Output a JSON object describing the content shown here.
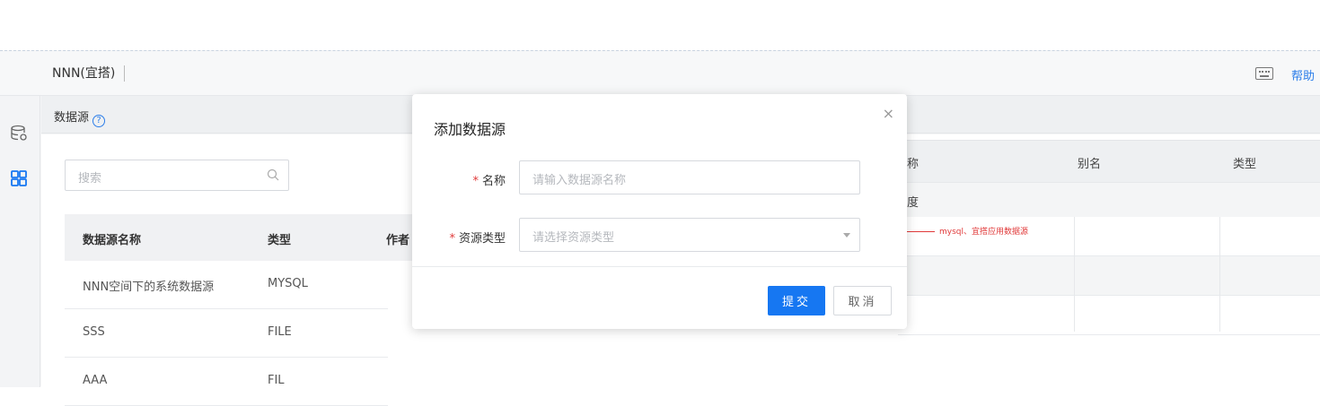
{
  "header": {
    "app_title": "NNN(宜搭)",
    "help_label": "帮助"
  },
  "breadcrumb": {
    "title": "数据源",
    "help_symbol": "?"
  },
  "search": {
    "placeholder": "搜索"
  },
  "table": {
    "columns": [
      "数据源名称",
      "类型",
      "作者"
    ],
    "rows": [
      {
        "name": "NNN空间下的系统数据源",
        "type": "MYSQL"
      },
      {
        "name": "SSS",
        "type": "FILE"
      },
      {
        "name": "AAA",
        "type": "FIL"
      }
    ]
  },
  "right_grid": {
    "columns": [
      "称",
      "别名",
      "类型"
    ],
    "sub_row": "度"
  },
  "annotation": {
    "text": "mysql、宜搭应用数据源",
    "color": "#e03a3a"
  },
  "modal": {
    "title": "添加数据源",
    "close_symbol": "×",
    "fields": [
      {
        "label": "名称",
        "required_mark": "*",
        "placeholder": "请输入数据源名称"
      },
      {
        "label": "资源类型",
        "required_mark": "*",
        "placeholder": "请选择资源类型"
      }
    ],
    "submit_label": "提交",
    "cancel_label": "取消"
  },
  "colors": {
    "primary": "#1677f2",
    "required": "#e03a3a",
    "link": "#2b7de9"
  }
}
